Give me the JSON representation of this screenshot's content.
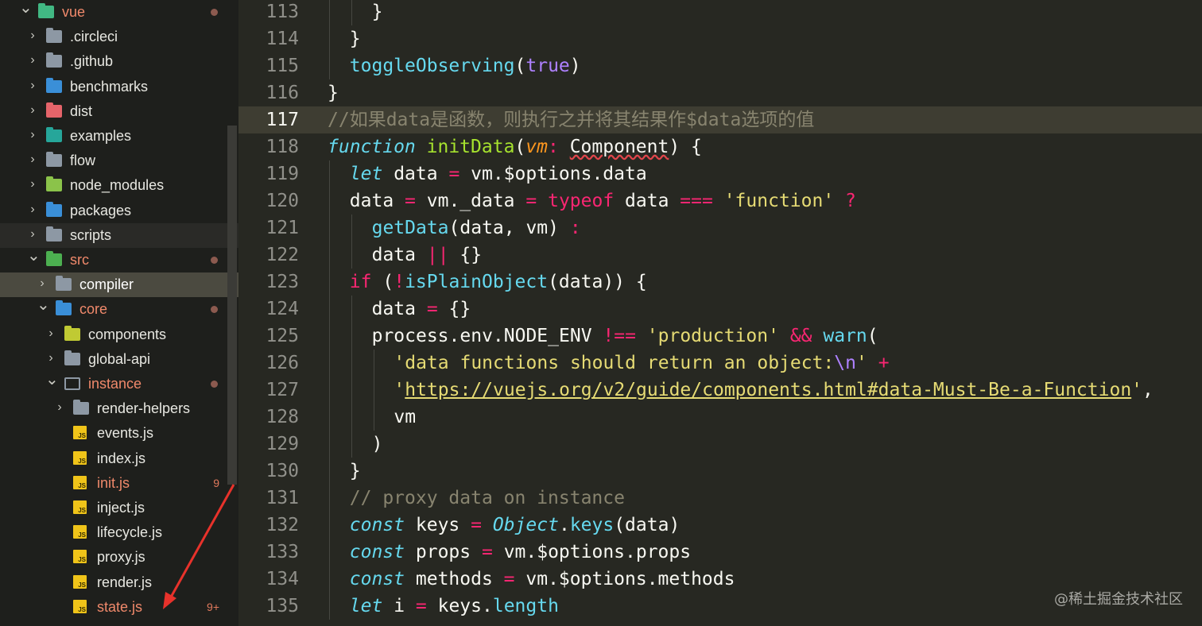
{
  "sidebar": {
    "items": [
      {
        "label": "vue",
        "open": true,
        "icon": "vue-folder-icon",
        "modified": true
      },
      {
        "label": ".circleci",
        "icon": "circleci-folder-icon"
      },
      {
        "label": ".github",
        "icon": "github-folder-icon"
      },
      {
        "label": "benchmarks",
        "icon": "benchmarks-folder-icon"
      },
      {
        "label": "dist",
        "icon": "dist-folder-icon"
      },
      {
        "label": "examples",
        "icon": "examples-folder-icon"
      },
      {
        "label": "flow",
        "icon": "folder-icon"
      },
      {
        "label": "node_modules",
        "icon": "node-folder-icon"
      },
      {
        "label": "packages",
        "icon": "packages-folder-icon"
      },
      {
        "label": "scripts",
        "icon": "scripts-folder-icon"
      },
      {
        "label": "src",
        "open": true,
        "icon": "src-folder-icon",
        "modified": true
      },
      {
        "label": "compiler",
        "icon": "folder-icon"
      },
      {
        "label": "core",
        "open": true,
        "icon": "core-folder-icon",
        "modified": true
      },
      {
        "label": "components",
        "icon": "components-folder-icon"
      },
      {
        "label": "global-api",
        "icon": "folder-icon"
      },
      {
        "label": "instance",
        "open": true,
        "icon": "open-folder-icon",
        "modified": true
      },
      {
        "label": "render-helpers",
        "icon": "folder-icon"
      },
      {
        "label": "events.js",
        "icon": "js-file-icon"
      },
      {
        "label": "index.js",
        "icon": "js-file-icon"
      },
      {
        "label": "init.js",
        "icon": "js-file-icon",
        "problems": "9"
      },
      {
        "label": "inject.js",
        "icon": "js-file-icon"
      },
      {
        "label": "lifecycle.js",
        "icon": "js-file-icon"
      },
      {
        "label": "proxy.js",
        "icon": "js-file-icon"
      },
      {
        "label": "render.js",
        "icon": "js-file-icon"
      },
      {
        "label": "state.js",
        "icon": "js-file-icon",
        "problems": "9+"
      }
    ]
  },
  "editor": {
    "current_line": "117",
    "lines": [
      {
        "n": "113",
        "indent": 2,
        "tokens": [
          [
            "p",
            "}"
          ]
        ]
      },
      {
        "n": "114",
        "indent": 1,
        "tokens": [
          [
            "p",
            "}"
          ]
        ]
      },
      {
        "n": "115",
        "indent": 1,
        "tokens": [
          [
            "call",
            "toggleObserving"
          ],
          [
            "p",
            "("
          ],
          [
            "num",
            "true"
          ],
          [
            "p",
            ")"
          ]
        ]
      },
      {
        "n": "116",
        "indent": 0,
        "tokens": [
          [
            "p",
            "}"
          ]
        ]
      },
      {
        "n": "117",
        "indent": 0,
        "tokens": [
          [
            "cm",
            "//如果data是函数，则执行之并将其结果作$data选项的值"
          ]
        ]
      },
      {
        "n": "118",
        "indent": 0,
        "tokens": [
          [
            "kwi",
            "function"
          ],
          [
            "p",
            " "
          ],
          [
            "fn",
            "initData"
          ],
          [
            "p",
            "("
          ],
          [
            "param",
            "vm"
          ],
          [
            "kw",
            ":"
          ],
          [
            "p",
            " "
          ],
          [
            "squig",
            "Component"
          ],
          [
            "p",
            ") {"
          ]
        ]
      },
      {
        "n": "119",
        "indent": 1,
        "tokens": [
          [
            "kwi",
            "let"
          ],
          [
            "p",
            " data "
          ],
          [
            "kw",
            "="
          ],
          [
            "p",
            " vm.$options.data"
          ]
        ]
      },
      {
        "n": "120",
        "indent": 1,
        "tokens": [
          [
            "p",
            "data "
          ],
          [
            "kw",
            "="
          ],
          [
            "p",
            " vm._data "
          ],
          [
            "kw",
            "="
          ],
          [
            "p",
            " "
          ],
          [
            "kw",
            "typeof"
          ],
          [
            "p",
            " data "
          ],
          [
            "kw",
            "==="
          ],
          [
            "p",
            " "
          ],
          [
            "str",
            "'function'"
          ],
          [
            "p",
            " "
          ],
          [
            "kw",
            "?"
          ]
        ]
      },
      {
        "n": "121",
        "indent": 2,
        "tokens": [
          [
            "call",
            "getData"
          ],
          [
            "p",
            "(data, vm) "
          ],
          [
            "kw",
            ":"
          ]
        ]
      },
      {
        "n": "122",
        "indent": 2,
        "tokens": [
          [
            "p",
            "data "
          ],
          [
            "kw",
            "||"
          ],
          [
            "p",
            " {}"
          ]
        ]
      },
      {
        "n": "123",
        "indent": 1,
        "tokens": [
          [
            "kw",
            "if"
          ],
          [
            "p",
            " ("
          ],
          [
            "kw",
            "!"
          ],
          [
            "call",
            "isPlainObject"
          ],
          [
            "p",
            "(data)) {"
          ]
        ]
      },
      {
        "n": "124",
        "indent": 2,
        "tokens": [
          [
            "p",
            "data "
          ],
          [
            "kw",
            "="
          ],
          [
            "p",
            " {}"
          ]
        ]
      },
      {
        "n": "125",
        "indent": 2,
        "tokens": [
          [
            "p",
            "process.env.NODE_ENV "
          ],
          [
            "kw",
            "!=="
          ],
          [
            "p",
            " "
          ],
          [
            "str",
            "'production'"
          ],
          [
            "p",
            " "
          ],
          [
            "kw",
            "&&"
          ],
          [
            "p",
            " "
          ],
          [
            "call",
            "warn"
          ],
          [
            "p",
            "("
          ]
        ]
      },
      {
        "n": "126",
        "indent": 3,
        "tokens": [
          [
            "str",
            "'data functions should return an object:"
          ],
          [
            "num",
            "\\n"
          ],
          [
            "str",
            "'"
          ],
          [
            "p",
            " "
          ],
          [
            "kw",
            "+"
          ]
        ]
      },
      {
        "n": "127",
        "indent": 3,
        "tokens": [
          [
            "str",
            "'"
          ],
          [
            "url",
            "https://vuejs.org/v2/guide/components.html#data-Must-Be-a-Function"
          ],
          [
            "str",
            "'"
          ],
          [
            "p",
            ","
          ]
        ]
      },
      {
        "n": "128",
        "indent": 3,
        "tokens": [
          [
            "p",
            "vm"
          ]
        ]
      },
      {
        "n": "129",
        "indent": 2,
        "tokens": [
          [
            "p",
            ")"
          ]
        ]
      },
      {
        "n": "130",
        "indent": 1,
        "tokens": [
          [
            "p",
            "}"
          ]
        ]
      },
      {
        "n": "131",
        "indent": 1,
        "tokens": [
          [
            "cm",
            "// proxy data on instance"
          ]
        ]
      },
      {
        "n": "132",
        "indent": 1,
        "tokens": [
          [
            "kwi",
            "const"
          ],
          [
            "p",
            " keys "
          ],
          [
            "kw",
            "="
          ],
          [
            "p",
            " "
          ],
          [
            "cls",
            "Object"
          ],
          [
            "p",
            "."
          ],
          [
            "call",
            "keys"
          ],
          [
            "p",
            "(data)"
          ]
        ]
      },
      {
        "n": "133",
        "indent": 1,
        "tokens": [
          [
            "kwi",
            "const"
          ],
          [
            "p",
            " props "
          ],
          [
            "kw",
            "="
          ],
          [
            "p",
            " vm.$options.props"
          ]
        ]
      },
      {
        "n": "134",
        "indent": 1,
        "tokens": [
          [
            "kwi",
            "const"
          ],
          [
            "p",
            " methods "
          ],
          [
            "kw",
            "="
          ],
          [
            "p",
            " vm.$options.methods"
          ]
        ]
      },
      {
        "n": "135",
        "indent": 1,
        "tokens": [
          [
            "kwi",
            "let"
          ],
          [
            "p",
            " i "
          ],
          [
            "kw",
            "="
          ],
          [
            "p",
            " keys."
          ],
          [
            "call",
            "length"
          ]
        ]
      }
    ]
  },
  "watermark": "@稀土掘金技术社区",
  "colors": {
    "editor_bg": "#272822",
    "sidebar_bg": "#1e1f1c",
    "keyword": "#f92672",
    "function": "#a6e22e",
    "string": "#e6db74",
    "comment": "#88846f",
    "annotation_arrow": "#e8322b"
  }
}
